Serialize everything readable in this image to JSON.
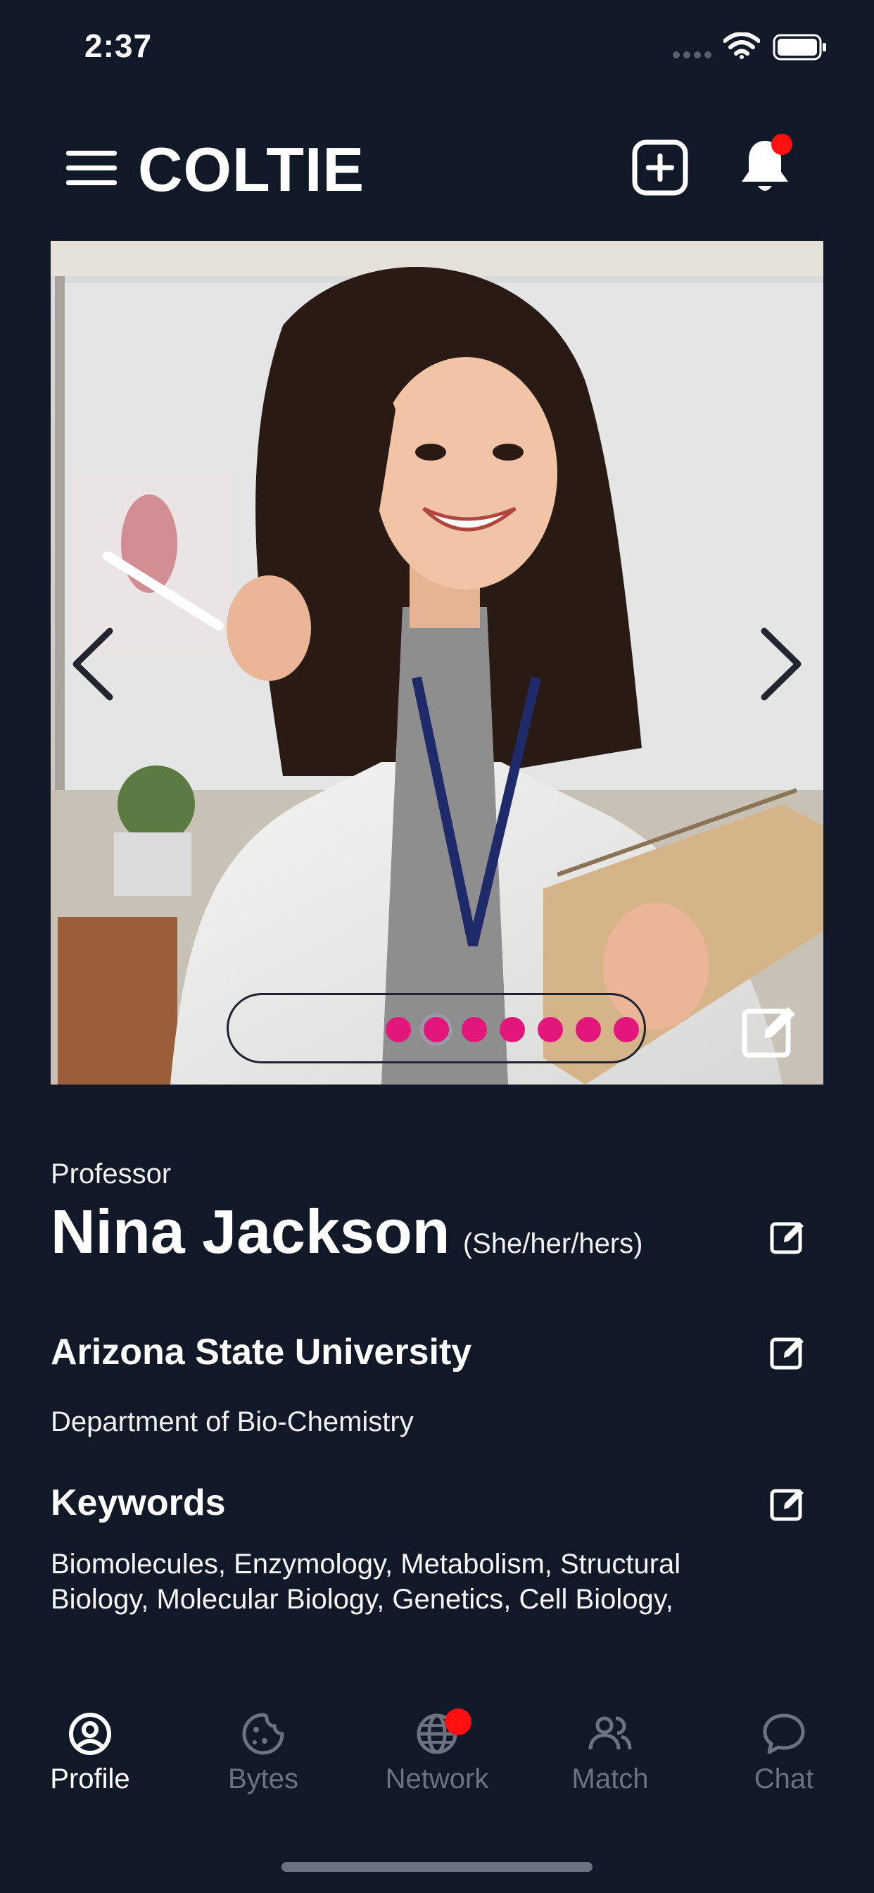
{
  "status_bar": {
    "time": "2:37"
  },
  "header": {
    "title": "COLTIE",
    "icons": [
      "menu-icon",
      "add-square-icon",
      "bell-icon"
    ],
    "notification_dot_color": "#ff1010"
  },
  "carousel": {
    "photo_count": 7,
    "active_index": 1,
    "dot_color": "#e3167b"
  },
  "profile": {
    "role": "Professor",
    "name": "Nina Jackson",
    "pronouns": "(She/her/hers)",
    "university": "Arizona State University",
    "department": "Department of Bio-Chemistry",
    "keywords_heading": "Keywords",
    "keywords_text": "Biomolecules, Enzymology, Metabolism, Structural Biology, Molecular Biology, Genetics, Cell Biology,"
  },
  "nav": {
    "items": [
      {
        "label": "Profile",
        "icon": "profile-icon",
        "active": true
      },
      {
        "label": "Bytes",
        "icon": "cookie-icon",
        "active": false
      },
      {
        "label": "Network",
        "icon": "globe-icon",
        "active": false
      },
      {
        "label": "Match",
        "icon": "users-icon",
        "active": false
      },
      {
        "label": "Chat",
        "icon": "chat-icon",
        "active": false
      }
    ]
  },
  "colors": {
    "background": "#111827",
    "accent": "#e3167b",
    "inactive_nav": "#6b7280"
  }
}
